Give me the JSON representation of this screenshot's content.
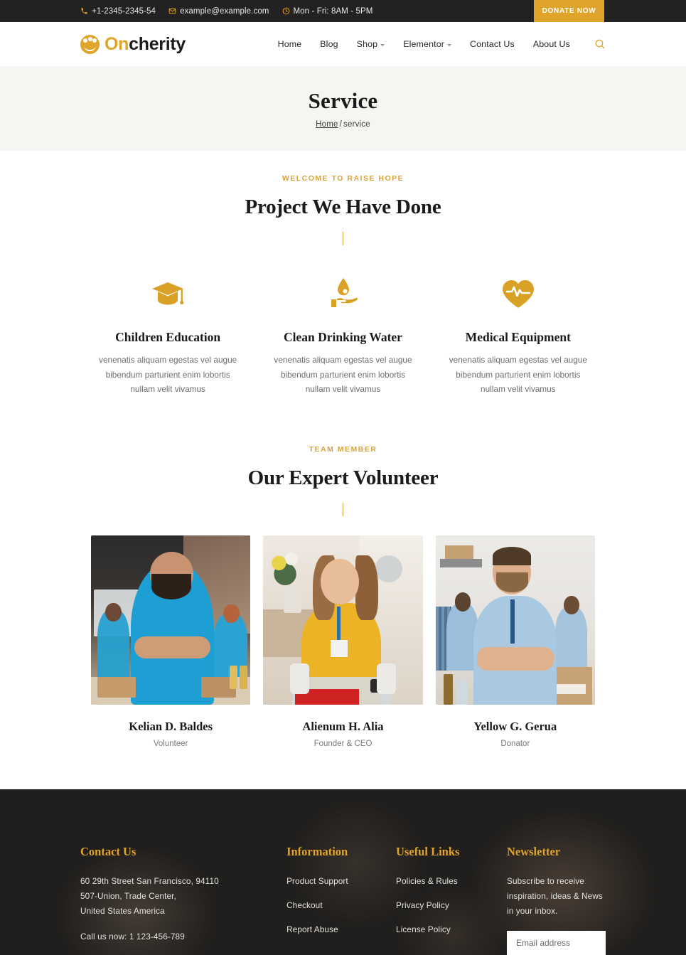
{
  "topbar": {
    "phone": "+1-2345-2345-54",
    "email": "example@example.com",
    "hours": "Mon - Fri: 8AM - 5PM",
    "donate_label": "DONATE NOW"
  },
  "header": {
    "logo_first": "On",
    "logo_second": "cherity",
    "nav": [
      {
        "label": "Home",
        "has_dropdown": false
      },
      {
        "label": "Blog",
        "has_dropdown": false
      },
      {
        "label": "Shop",
        "has_dropdown": true
      },
      {
        "label": "Elementor",
        "has_dropdown": true
      },
      {
        "label": "Contact Us",
        "has_dropdown": false
      },
      {
        "label": "About Us",
        "has_dropdown": false
      }
    ]
  },
  "banner": {
    "title": "Service",
    "crumb_home": "Home",
    "crumb_sep": "/",
    "crumb_current": "service"
  },
  "projects": {
    "eyebrow": "WELCOME TO RAISE HOPE",
    "title": "Project We Have Done",
    "items": [
      {
        "icon": "graduation-cap-icon",
        "title": "Children Education",
        "text": "venenatis aliquam egestas vel augue bibendum parturient enim lobortis nullam velit vivamus"
      },
      {
        "icon": "hand-water-drop-icon",
        "title": "Clean Drinking Water",
        "text": "venenatis aliquam egestas vel augue bibendum parturient enim lobortis nullam velit vivamus"
      },
      {
        "icon": "heart-pulse-icon",
        "title": "Medical Equipment",
        "text": "venenatis aliquam egestas vel augue bibendum parturient enim lobortis nullam velit vivamus"
      }
    ]
  },
  "team": {
    "eyebrow": "TEAM MEMBER",
    "title": "Our Expert Volunteer",
    "members": [
      {
        "name": "Kelian D. Baldes",
        "role": "Volunteer"
      },
      {
        "name": "Alienum H. Alia",
        "role": "Founder & CEO"
      },
      {
        "name": "Yellow G. Gerua",
        "role": "Donator"
      }
    ]
  },
  "footer": {
    "contact": {
      "title": "Contact Us",
      "address_line1": "60 29th Street San Francisco, 94110",
      "address_line2": "507-Union, Trade Center,",
      "address_line3": "United States America",
      "phone_line": "Call us now: 1 123-456-789"
    },
    "information": {
      "title": "Information",
      "links": [
        "Product Support",
        "Checkout",
        "Report Abuse"
      ]
    },
    "useful": {
      "title": "Useful Links",
      "links": [
        "Policies & Rules",
        "Privacy Policy",
        "License Policy"
      ]
    },
    "newsletter": {
      "title": "Newsletter",
      "text": "Subscribe to receive inspiration, ideas & News in your inbox.",
      "placeholder": "Email address",
      "value": ""
    }
  },
  "colors": {
    "accent": "#e0a42b",
    "dark": "#222222",
    "banner_bg": "#f6f5f1",
    "footer_bg": "#211f1d"
  }
}
